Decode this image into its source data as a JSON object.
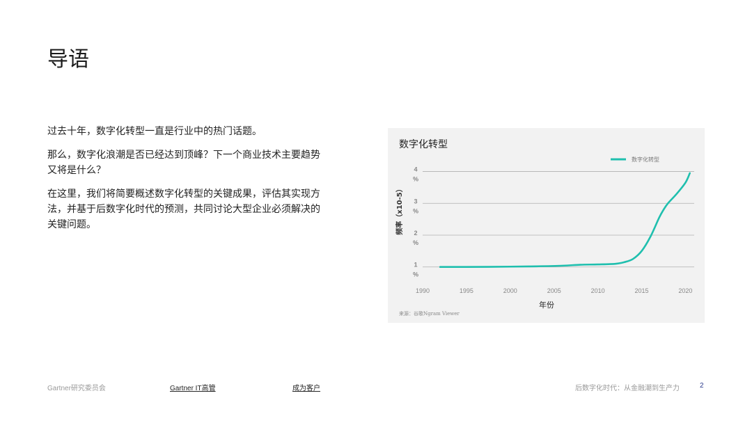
{
  "slide": {
    "title": "导语",
    "paragraphs": [
      "过去十年，数字化转型一直是行业中的热门话题。",
      "那么，数字化浪潮是否已经达到顶峰？下一个商业技术主要趋势又将是什么？",
      "在这里，我们将简要概述数字化转型的关键成果，评估其实现方法，并基于后数字化时代的预测，共同讨论大型企业必须解决的关键问题。"
    ]
  },
  "chart_data": {
    "type": "line",
    "title": "数字化转型",
    "xlabel": "年份",
    "ylabel": "频率（x10-5）",
    "source": "来源：谷歌Ngram Viewer",
    "legend": {
      "label": "数字化转型",
      "position": "top-right"
    },
    "x_ticks": [
      "1990",
      "1995",
      "2000",
      "2005",
      "2010",
      "2015",
      "2020"
    ],
    "y_ticks": [
      {
        "value": 1,
        "label": "1 %"
      },
      {
        "value": 2,
        "label": "2 %"
      },
      {
        "value": 3,
        "label": "3 %"
      },
      {
        "value": 4,
        "label": "4 %"
      }
    ],
    "xlim": [
      1990,
      2021
    ],
    "ylim": [
      0.6,
      4.1
    ],
    "grid": true,
    "series": [
      {
        "name": "数字化转型",
        "color": "#1fbfae",
        "x": [
          1992,
          1995,
          2000,
          2003,
          2006,
          2008,
          2010,
          2012,
          2013,
          2014,
          2015,
          2016,
          2017,
          2017.5,
          2018,
          2019,
          2020,
          2020.5
        ],
        "y": [
          1.0,
          1.0,
          1.01,
          1.02,
          1.04,
          1.07,
          1.08,
          1.1,
          1.15,
          1.25,
          1.5,
          1.95,
          2.55,
          2.8,
          3.0,
          3.3,
          3.65,
          3.95
        ]
      }
    ]
  },
  "footer": {
    "org": "Gartner研究委员会",
    "link1": "Gartner IT高管",
    "link2": "成为客户",
    "doc_title": "后数字化时代：从金融潮到生产力",
    "page": "2"
  }
}
